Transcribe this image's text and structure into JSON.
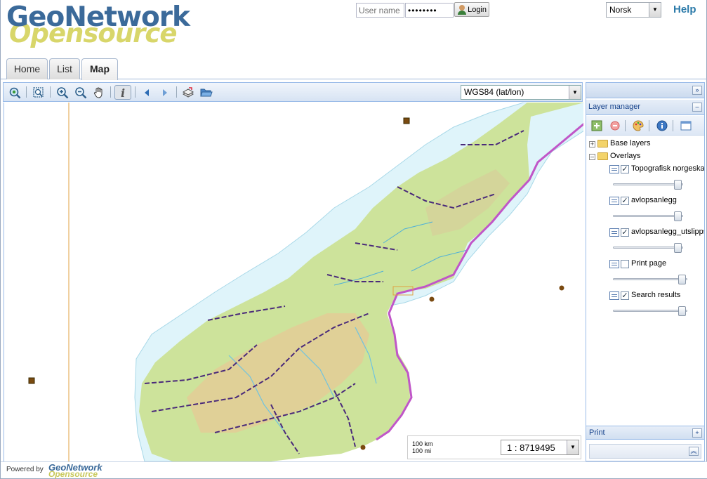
{
  "header": {
    "logo_top": "GeoNetwork",
    "logo_bottom": "Opensource",
    "username_placeholder": "User name",
    "password_mask": "••••••••",
    "login_label": "Login",
    "language": "Norsk",
    "help_label": "Help"
  },
  "tabs": [
    {
      "label": "Home"
    },
    {
      "label": "List"
    },
    {
      "label": "Map",
      "active": true
    }
  ],
  "toolbar": {
    "projection": "WGS84 (lat/lon)",
    "tools": [
      "zoom-extent-icon",
      "zoom-box-icon",
      "zoom-in-icon",
      "zoom-out-icon",
      "pan-hand-icon",
      "info-icon",
      "previous-view-icon",
      "next-view-icon",
      "add-layer-icon",
      "open-folder-icon"
    ]
  },
  "map": {
    "scale_km": "100 km",
    "scale_mi": "100 mi",
    "scale_value": "1 : 8719495"
  },
  "layer_manager": {
    "title": "Layer manager",
    "base_layers_label": "Base layers",
    "overlays_label": "Overlays",
    "layers": [
      {
        "name": "Topografisk norgeskart",
        "checked": true,
        "opacity": 1.0
      },
      {
        "name": "avlopsanlegg",
        "checked": true,
        "opacity": 1.0
      },
      {
        "name": "avlopsanlegg_utslippspunkt",
        "checked": true,
        "opacity": 1.0
      },
      {
        "name": "Print page",
        "checked": false,
        "opacity": 1.0
      },
      {
        "name": "Search results",
        "checked": true,
        "opacity": 1.0
      }
    ]
  },
  "print_panel": {
    "title": "Print"
  },
  "footer": {
    "powered_by": "Powered by",
    "logo_top": "GeoNetwork",
    "logo_bottom": "Opensource"
  },
  "colors": {
    "accent": "#3b6a9a",
    "logo_yellow": "#d4d25a",
    "help_blue": "#2b7aa9",
    "sea": "#dff4fa",
    "land": "#cde39b",
    "border_purple": "#c056c8"
  }
}
